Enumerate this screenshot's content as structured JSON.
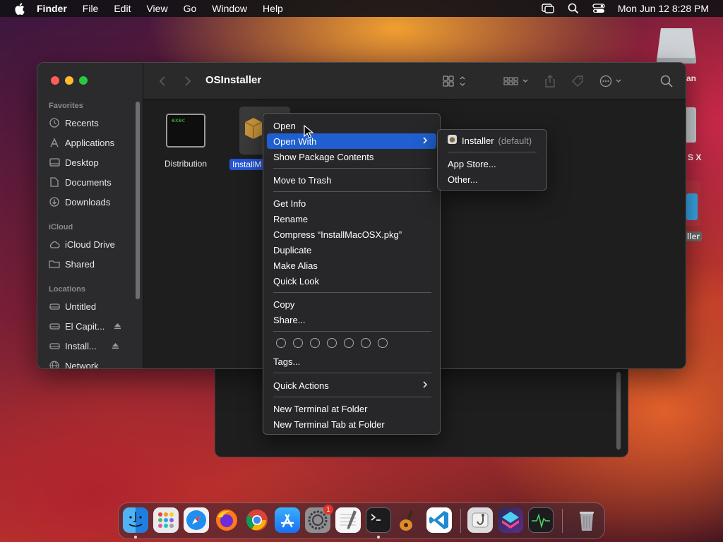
{
  "menubar": {
    "app_name": "Finder",
    "items": [
      "File",
      "Edit",
      "View",
      "Go",
      "Window",
      "Help"
    ],
    "clock": "Mon Jun 12  8:28 PM"
  },
  "desktop": {
    "icon_labels": [
      "an",
      "S X",
      "ller"
    ]
  },
  "finder": {
    "title": "OSInstaller",
    "sidebar": {
      "favorites_heading": "Favorites",
      "favorites": [
        "Recents",
        "Applications",
        "Desktop",
        "Documents",
        "Downloads"
      ],
      "icloud_heading": "iCloud",
      "icloud": [
        "iCloud Drive",
        "Shared"
      ],
      "locations_heading": "Locations",
      "locations": [
        "Untitled",
        "El Capit...",
        "Install...",
        "Network"
      ]
    },
    "files": [
      {
        "name": "Distribution",
        "icon_text": "exec"
      },
      {
        "name": "InstallM"
      }
    ]
  },
  "context_menu": {
    "items": {
      "open": "Open",
      "open_with": "Open With",
      "show_package": "Show Package Contents",
      "move_trash": "Move to Trash",
      "get_info": "Get Info",
      "rename": "Rename",
      "compress": "Compress “InstallMacOSX.pkg”",
      "duplicate": "Duplicate",
      "make_alias": "Make Alias",
      "quick_look": "Quick Look",
      "copy": "Copy",
      "share": "Share...",
      "tags": "Tags...",
      "quick_actions": "Quick Actions",
      "new_terminal": "New Terminal at Folder",
      "new_terminal_tab": "New Terminal Tab at Folder"
    },
    "tag_colors": 7
  },
  "open_with_submenu": {
    "installer": "Installer",
    "installer_suffix": "(default)",
    "app_store": "App Store...",
    "other": "Other..."
  },
  "dock": {
    "badge_count": "1",
    "apps": [
      "finder",
      "launchpad",
      "safari",
      "firefox",
      "chrome",
      "app-store",
      "system-settings",
      "textedit",
      "terminal",
      "garageband",
      "vscode",
      "disk-utility",
      "shortcuts",
      "activity-monitor",
      "trash"
    ]
  }
}
